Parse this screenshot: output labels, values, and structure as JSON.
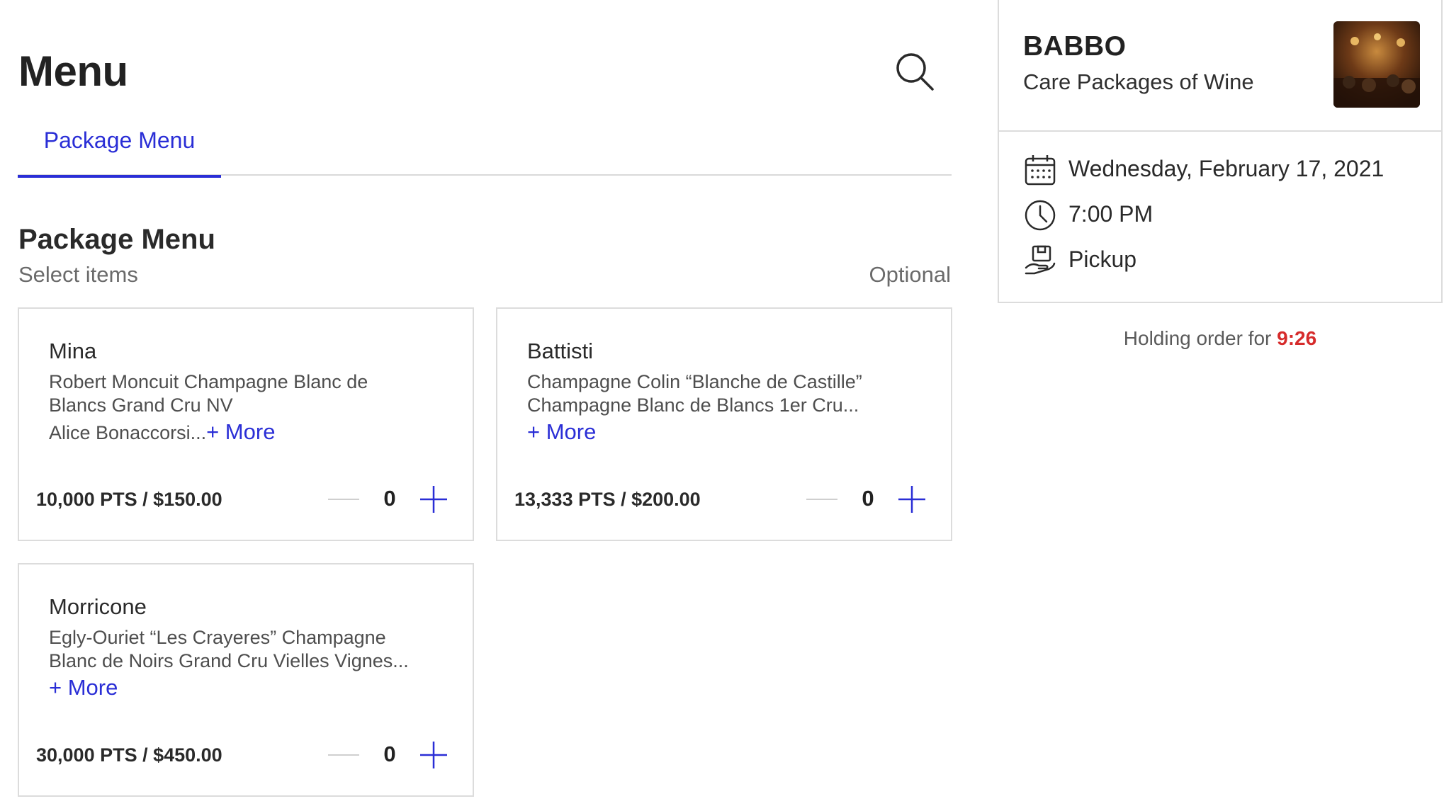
{
  "page": {
    "title": "Menu"
  },
  "tabs": [
    {
      "label": "Package Menu",
      "active": true
    }
  ],
  "section": {
    "title": "Package Menu",
    "subtitle": "Select items",
    "optional_label": "Optional"
  },
  "packages": [
    {
      "name": "Mina",
      "desc_line1": "Robert Moncuit Champagne Blanc de",
      "desc_line2": "Blancs Grand Cru NV",
      "desc_line3": "Alice Bonaccorsi...",
      "more": "+ More",
      "price": "10,000 PTS / $150.00",
      "qty": "0"
    },
    {
      "name": "Battisti",
      "desc_line1": "Champagne Colin “Blanche de Castille”",
      "desc_line2": "Champagne Blanc de Blancs 1er Cru...",
      "more": "+ More",
      "price": "13,333 PTS / $200.00",
      "qty": "0"
    },
    {
      "name": "Morricone",
      "desc_line1": "Egly-Ouriet “Les Crayeres” Champagne",
      "desc_line2": "Blanc de Noirs Grand Cru Vielles Vignes...",
      "more": "+ More",
      "price": "30,000 PTS / $450.00",
      "qty": "0"
    }
  ],
  "restaurant": {
    "name": "BABBO",
    "subtitle": "Care Packages of Wine",
    "date": "Wednesday, February 17, 2021",
    "time": "7:00 PM",
    "method": "Pickup"
  },
  "holding": {
    "label": "Holding order for",
    "timer": "9:26"
  },
  "colors": {
    "accent": "#2a2ed6",
    "timer": "#d62b2b",
    "border": "#dcdcdc"
  },
  "icons": [
    "search-icon",
    "minus-icon",
    "plus-icon",
    "calendar-icon",
    "clock-icon",
    "pickup-icon"
  ]
}
